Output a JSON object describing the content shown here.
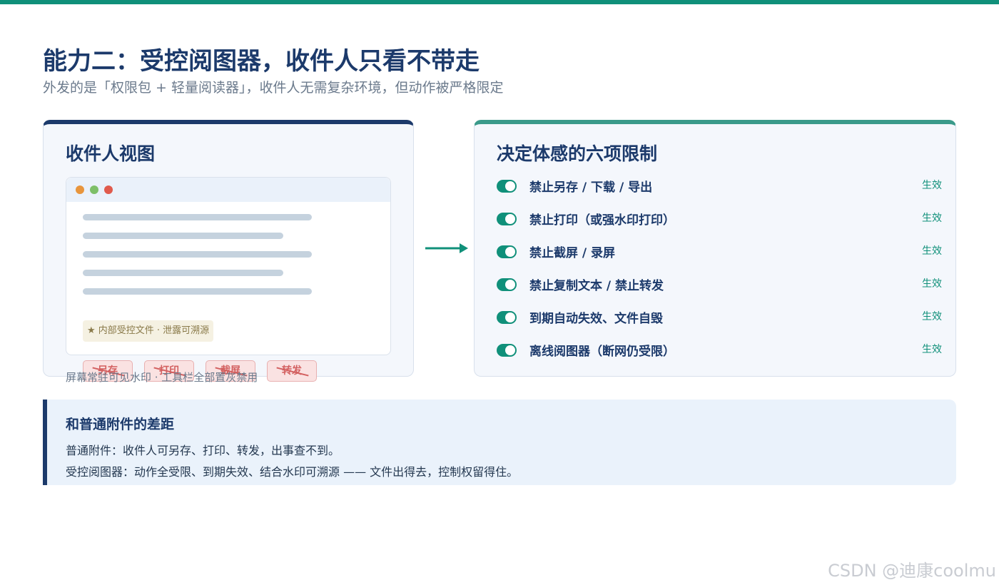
{
  "header": {
    "title": "能力二：受控阅图器，收件人只看不带走",
    "subtitle": "外发的是「权限包 + 轻量阅读器」，收件人无需复杂环境，但动作被严格限定"
  },
  "left_card": {
    "title": "收件人视图",
    "watermark": "★ 内部受控文件 · 泄露可溯源",
    "disabled_actions": [
      "另存",
      "打印",
      "截屏",
      "转发"
    ],
    "note": "屏幕常驻可见水印 · 工具栏全部置灰禁用"
  },
  "right_card": {
    "title": "决定体感的六项限制",
    "rules": [
      {
        "label": "禁止另存 / 下载 / 导出",
        "status": "生效"
      },
      {
        "label": "禁止打印（或强水印打印）",
        "status": "生效"
      },
      {
        "label": "禁止截屏 / 录屏",
        "status": "生效"
      },
      {
        "label": "禁止复制文本 / 禁止转发",
        "status": "生效"
      },
      {
        "label": "到期自动失效、文件自毁",
        "status": "生效"
      },
      {
        "label": "离线阅图器（断网仍受限）",
        "status": "生效"
      }
    ]
  },
  "comparison": {
    "title": "和普通附件的差距",
    "line1": "普通附件：收件人可另存、打印、转发，出事查不到。",
    "line2": "受控阅图器：动作全受限、到期失效、结合水印可溯源 —— 文件出得去，控制权留得住。"
  },
  "credit": "CSDN @迪康coolmu",
  "colors": {
    "accent": "#10907a",
    "navy": "#1c3a6b",
    "teal_bar": "#3a9a8a",
    "danger": "#d36060"
  }
}
